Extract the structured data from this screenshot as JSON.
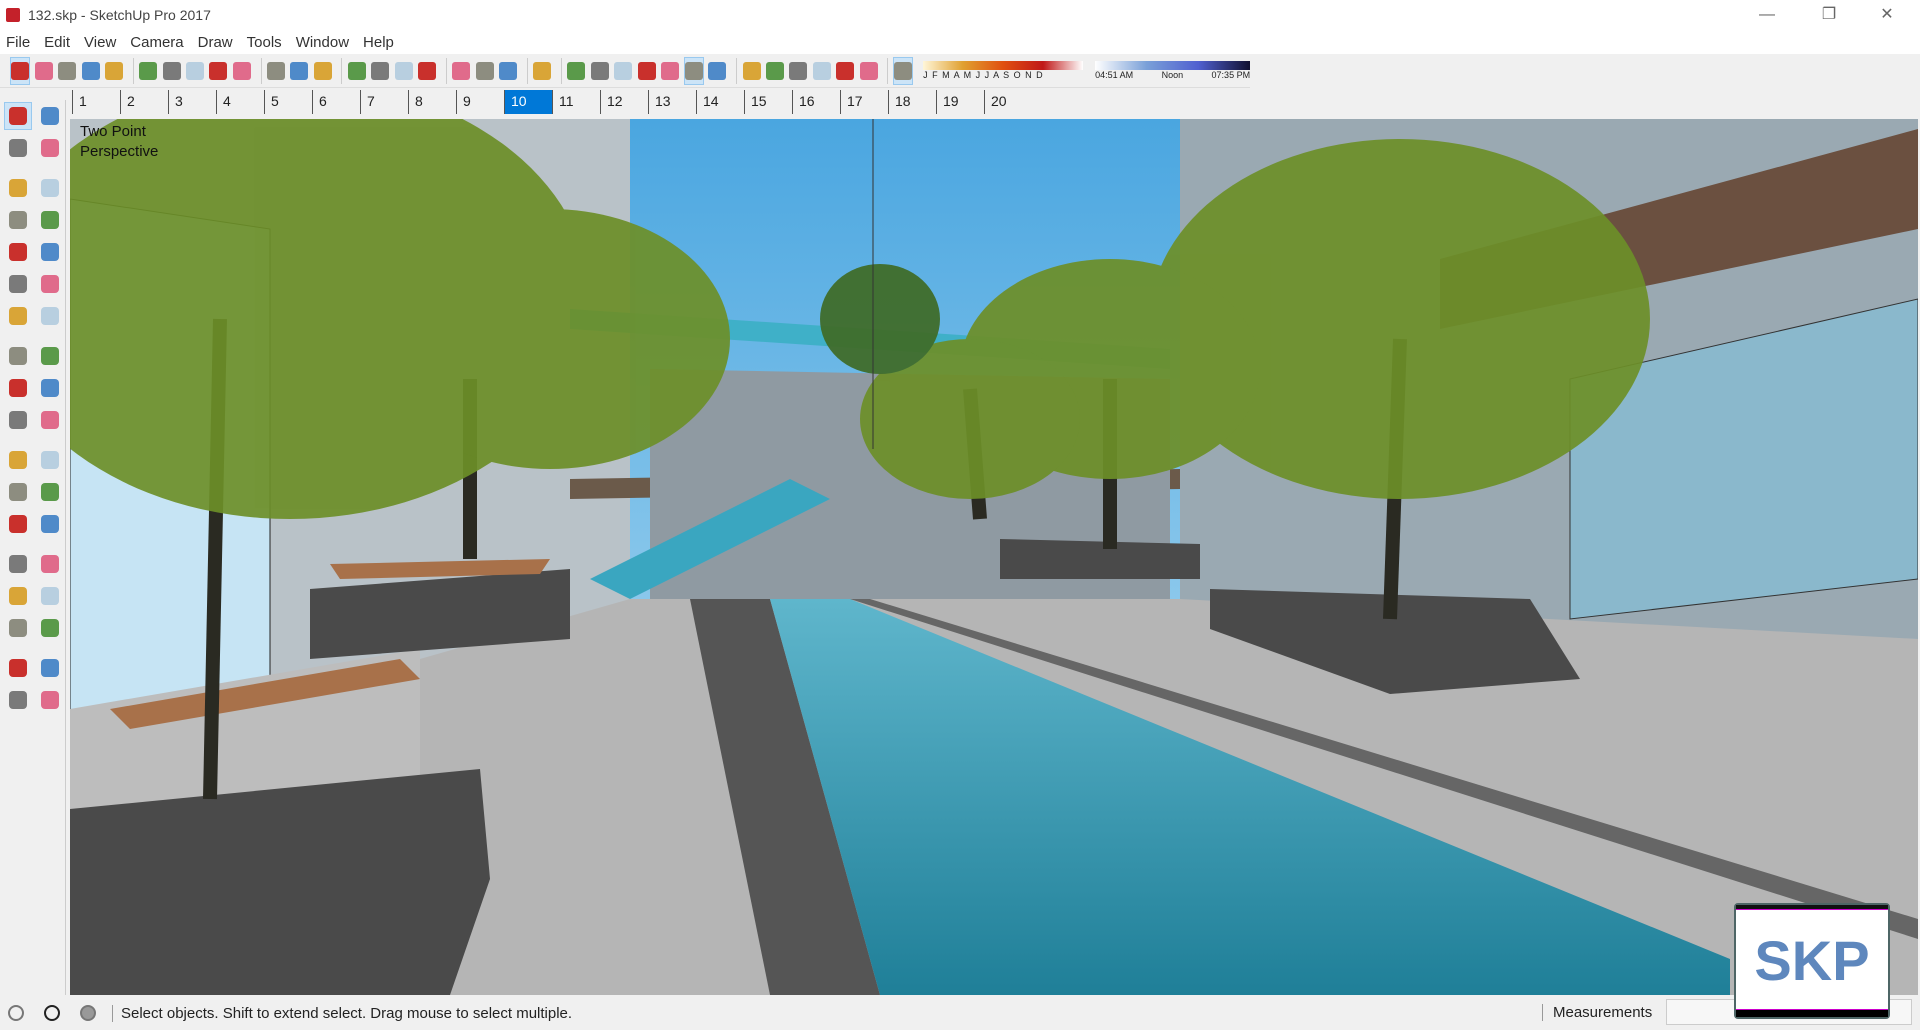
{
  "window": {
    "title": "132.skp - SketchUp Pro 2017",
    "min": "—",
    "max": "❐",
    "close": "✕"
  },
  "menu": [
    "File",
    "Edit",
    "View",
    "Camera",
    "Draw",
    "Tools",
    "Window",
    "Help"
  ],
  "toolbar": {
    "groups": [
      [
        "select",
        "eraser",
        "line",
        "arc",
        "rectangle"
      ],
      [
        "push-pull",
        "follow-me",
        "move",
        "rotate",
        "scale"
      ],
      [
        "tape-measure",
        "text",
        "paint-bucket"
      ],
      [
        "orbit",
        "pan",
        "zoom",
        "zoom-extents"
      ],
      [
        "3d-warehouse",
        "extension-warehouse",
        "layout"
      ],
      [
        "ruby-console"
      ],
      [
        "xray",
        "back-edges",
        "wireframe",
        "hidden-line",
        "shaded",
        "shaded-textures",
        "monochrome"
      ],
      [
        "iso-view",
        "top-view",
        "front-view",
        "right-view",
        "back-view",
        "left-view"
      ],
      [
        "shadows"
      ]
    ],
    "active": [
      "select",
      "shaded-textures",
      "shadows"
    ],
    "shadow": {
      "months": "J F M A M J J A S O N D",
      "time_start": "04:51 AM",
      "time_mid": "Noon",
      "time_end": "07:35 PM"
    }
  },
  "scene_tabs": [
    "1",
    "2",
    "3",
    "4",
    "5",
    "6",
    "7",
    "8",
    "9",
    "10",
    "11",
    "12",
    "13",
    "14",
    "15",
    "16",
    "17",
    "18",
    "19",
    "20"
  ],
  "selected_scene": "10",
  "left_tools": [
    "select",
    "component",
    "paint-bucket",
    "eraser",
    "line",
    "freehand",
    "rectangle",
    "rotated-rectangle",
    "circle",
    "polygon",
    "arc",
    "2pt-arc",
    "3pt-arc",
    "pie",
    "move",
    "push-pull",
    "rotate",
    "follow-me",
    "scale",
    "offset",
    "tape-measure",
    "dimension",
    "protractor",
    "text",
    "axes",
    "3d-text",
    "orbit",
    "pan",
    "zoom",
    "zoom-window",
    "zoom-extents",
    "previous-view",
    "position-camera",
    "look-around",
    "walk",
    "section-plane"
  ],
  "viewport": {
    "camera_label_1": "Two Point",
    "camera_label_2": "Perspective"
  },
  "status": {
    "text": "Select objects. Shift to extend select. Drag mouse to select multiple.",
    "measurements_label": "Measurements",
    "measurements_value": ""
  },
  "watermark": "SKP",
  "colors": {
    "accent": "#0078d7",
    "sky": "#8cc7ea",
    "water": "#2e8fa8"
  }
}
